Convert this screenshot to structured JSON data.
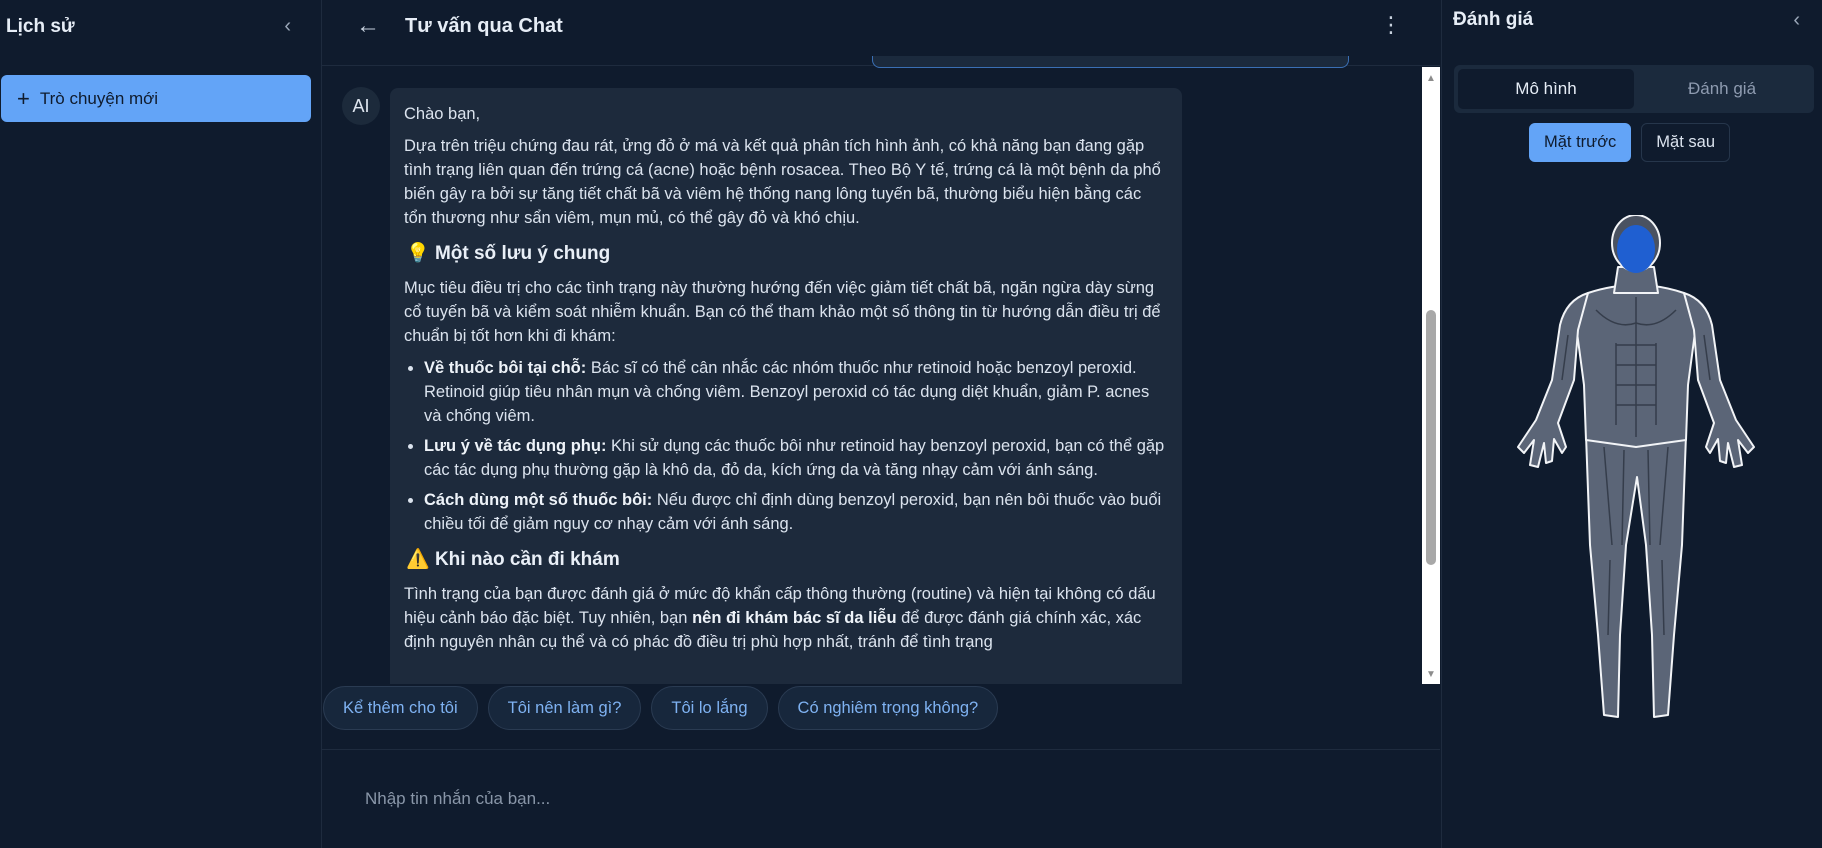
{
  "sidebar": {
    "title": "Lịch sử",
    "collapse_icon": "chevron-left-icon",
    "new_chat_label": "Trò chuyện mới"
  },
  "chat": {
    "title": "Tư vấn qua Chat",
    "back_icon": "arrow-left-icon",
    "menu_icon": "more-vertical-icon",
    "avatar_label": "AI",
    "message": {
      "greeting": "Chào bạn,",
      "intro": "Dựa trên triệu chứng đau rát, ửng đỏ ở má và kết quả phân tích hình ảnh, có khả năng bạn đang gặp tình trạng liên quan đến trứng cá (acne) hoặc bệnh rosacea. Theo Bộ Y tế, trứng cá là một bệnh da phổ biến gây ra bởi sự tăng tiết chất bã và viêm hệ thống nang lông tuyến bã, thường biểu hiện bằng các tổn thương như sẩn viêm, mụn mủ, có thể gây đỏ và khó chịu.",
      "section1_icon": "💡",
      "section1_title": "Một số lưu ý chung",
      "section1_text": "Mục tiêu điều trị cho các tình trạng này thường hướng đến việc giảm tiết chất bã, ngăn ngừa dày sừng cổ tuyến bã và kiểm soát nhiễm khuẩn. Bạn có thể tham khảo một số thông tin từ hướng dẫn điều trị để chuẩn bị tốt hơn khi đi khám:",
      "bullets": [
        {
          "bold": "Về thuốc bôi tại chỗ:",
          "text": " Bác sĩ có thể cân nhắc các nhóm thuốc như retinoid hoặc benzoyl peroxid. Retinoid giúp tiêu nhân mụn và chống viêm. Benzoyl peroxid có tác dụng diệt khuẩn, giảm P. acnes và chống viêm."
        },
        {
          "bold": "Lưu ý về tác dụng phụ:",
          "text": " Khi sử dụng các thuốc bôi như retinoid hay benzoyl peroxid, bạn có thể gặp các tác dụng phụ thường gặp là khô da, đỏ da, kích ứng da và tăng nhạy cảm với ánh sáng."
        },
        {
          "bold": "Cách dùng một số thuốc bôi:",
          "text": " Nếu được chỉ định dùng benzoyl peroxid, bạn nên bôi thuốc vào buổi chiều tối để giảm nguy cơ nhạy cảm với ánh sáng."
        }
      ],
      "section2_icon": "⚠️",
      "section2_title": "Khi nào cần đi khám",
      "section2_pre": "Tình trạng của bạn được đánh giá ở mức độ khẩn cấp thông thường (routine) và hiện tại không có dấu hiệu cảnh báo đặc biệt. Tuy nhiên, bạn ",
      "section2_bold": "nên đi khám bác sĩ da liễu",
      "section2_post": " để được đánh giá chính xác, xác định nguyên nhân cụ thể và có phác đồ điều trị phù hợp nhất, tránh để tình trạng"
    },
    "suggestions": [
      "Kể thêm cho tôi",
      "Tôi nên làm gì?",
      "Tôi lo lắng",
      "Có nghiêm trọng không?"
    ],
    "input_placeholder": "Nhập tin nhắn của bạn..."
  },
  "right_panel": {
    "title": "Đánh giá",
    "collapse_icon": "chevron-left-icon",
    "tabs": [
      "Mô hình",
      "Đánh giá"
    ],
    "active_tab": "Mô hình",
    "view_toggle": [
      "Mặt trước",
      "Mặt sau"
    ],
    "active_view": "Mặt trước",
    "highlighted_region": "face",
    "highlight_color": "#1f5fd1"
  }
}
